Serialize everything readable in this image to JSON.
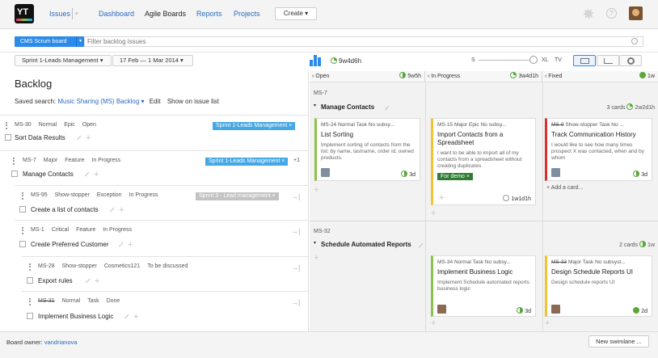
{
  "nav": {
    "issues": "Issues",
    "issues_dropdown": "▾",
    "dashboard": "Dashboard",
    "agile_boards": "Agile Boards",
    "reports": "Reports",
    "projects": "Projects",
    "create": "Create ▾"
  },
  "toolbar": {
    "board_name": "CMS Scrum board",
    "board_arrow": "▾",
    "filter_placeholder": "Filter backlog issues"
  },
  "sprint": {
    "name": "Sprint 1-Leads Management ▾",
    "dates": "17 Feb — 1 Mar 2014 ▾",
    "estimate": "9w4d6h",
    "zoom_s": "S",
    "zoom_xl": "XL",
    "zoom_tv": "TV"
  },
  "backlog": {
    "title": "Backlog",
    "saved_search_label": "Saved search: ",
    "saved_search_value": "Music Sharing (MS) Backlog ▾",
    "edit": "Edit",
    "show_on_issue_list": "Show on issue list",
    "issues": [
      {
        "id": "MS-30",
        "priority": "Normal",
        "type": "Epic",
        "state": "Open",
        "tag": "Sprint 1-Leads Management ×",
        "summary": "Sort Data Results"
      },
      {
        "id": "MS-7",
        "priority": "Major",
        "type": "Feature",
        "state": "In Progress",
        "tag": "Sprint 1-Leads Management ×",
        "extra": "+1",
        "summary": "Manage Contacts"
      },
      {
        "id": "MS-95",
        "priority": "Show-stopper",
        "type": "Exception",
        "state": "In Progress",
        "tag": "Sprint 3 - Lead management ×",
        "summary": "Create a list of contacts"
      },
      {
        "id": "MS-1",
        "priority": "Critical",
        "type": "Feature",
        "state": "In Progress",
        "summary": "Create Preferred Customer"
      },
      {
        "id": "MS-28",
        "priority": "Show-stopper",
        "type": "Cosmetics121",
        "state": "To be discussed",
        "summary": "Export rules"
      },
      {
        "id": "MS-31",
        "priority": "Normal",
        "type": "Task",
        "state": "Done",
        "summary": "Implement Business Logic"
      }
    ]
  },
  "columns": [
    {
      "name": "‹ Open",
      "time": "5w5h"
    },
    {
      "name": "‹ In Progress",
      "time": "3w4d1h"
    },
    {
      "name": "‹ Fixed",
      "time": "1w"
    }
  ],
  "swimlanes": [
    {
      "id": "MS-7",
      "title": "Manage Contacts",
      "count": "3 cards",
      "time": "2w2d1h",
      "cards": [
        {
          "meta": "MS-24  Normal  Task  No subsy...",
          "title": "List Sorting",
          "desc": "Implement sorting of contacts from the list: by name, lastname, order id, owned products.",
          "time": "3d"
        },
        {
          "meta": "MS-15  Major  Epic  No subsy...",
          "title": "Import Contacts from a Spreadsheet",
          "desc": "I want to be able to import all of my contacts from a spreadsheet without creating duplicates",
          "tag": "For demo ×",
          "time": "1w1d1h"
        },
        {
          "meta_id": "MS-9",
          "meta": "  Show-stopper  Task  No ...",
          "title": "Track Communication History",
          "desc": "I would like to see how many times prospect X was contacted, when and by whom",
          "time": "3d"
        }
      ],
      "add_card": "Add a card..."
    },
    {
      "id": "MS-32",
      "title": "Schedule Automated Reports",
      "count": "2 cards",
      "time": "1w",
      "cards": [
        {
          "meta": "MS-34  Normal  Task  No subsy...",
          "title": "Implement Business Logic",
          "desc": "Implement Schedule automated reports business logic",
          "time": "3d"
        },
        {
          "meta_id": "MS-33",
          "meta": "  Major  Task  No subsyst...",
          "title": "Design Schedule Reports UI",
          "desc": "Design schedule reports UI",
          "time": "2d"
        }
      ]
    }
  ],
  "footer": {
    "owner_label": "Board owner: ",
    "owner": "vandrianova",
    "new_swimlane": "New swimlane ..."
  },
  "icons": [
    "logo-icon",
    "gear-icon",
    "help-icon",
    "avatar",
    "search-icon",
    "chart-icon",
    "pencil-icon",
    "plus-icon",
    "arrow-right-icon",
    "drag-handle-icon"
  ]
}
